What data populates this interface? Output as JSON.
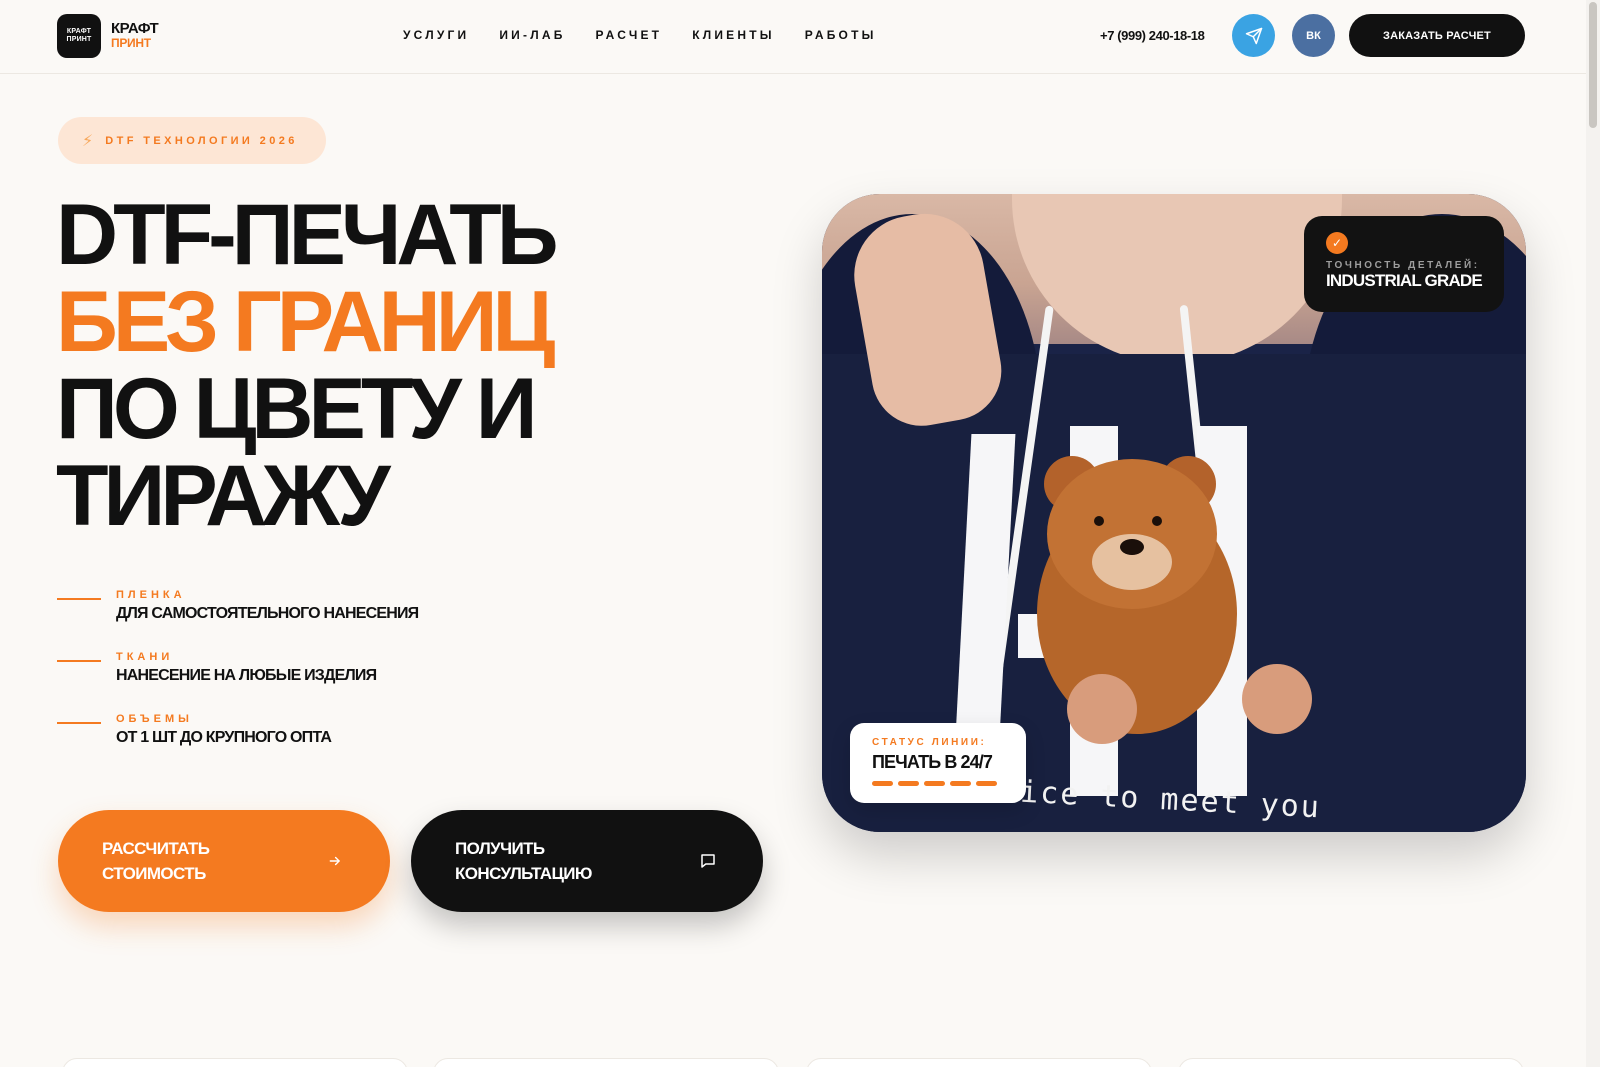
{
  "header": {
    "logo_box_line1": "КРАФТ",
    "logo_box_line2": "ПРИНТ",
    "logo_title": "КРАФТ",
    "logo_subtitle": "ПРИНТ",
    "nav": [
      "УСЛУГИ",
      "ИИ-ЛАБ",
      "РАСЧЕТ",
      "КЛИЕНТЫ",
      "РАБОТЫ"
    ],
    "phone": "+7 (999) 240-18-18",
    "vk_label": "ВК",
    "order_button": "ЗАКАЗАТЬ РАСЧЕТ"
  },
  "hero": {
    "badge": "DTF ТЕХНОЛОГИИ 2026",
    "headline_1": "DTF-ПЕЧАТЬ",
    "headline_2": "БЕЗ ГРАНИЦ",
    "headline_3": "ПО ЦВЕТУ И",
    "headline_4": "ТИРАЖУ",
    "features": [
      {
        "key": "ПЛЕНКА",
        "value": "ДЛЯ САМОСТОЯТЕЛЬНОГО НАНЕСЕНИЯ"
      },
      {
        "key": "ТКАНИ",
        "value": "НАНЕСЕНИЕ НА ЛЮБЫЕ ИЗДЕЛИЯ"
      },
      {
        "key": "ОБЪЕМЫ",
        "value": "ОТ 1 ШТ ДО КРУПНОГО ОПТА"
      }
    ],
    "cta_calc_line1": "РАССЧИТАТЬ",
    "cta_calc_line2": "СТОИМОСТЬ",
    "cta_consult_line1": "ПОЛУЧИТЬ",
    "cta_consult_line2": "КОНСУЛЬТАЦИЮ"
  },
  "image": {
    "slogan": "nice to meet you",
    "card_top_key": "ТОЧНОСТЬ ДЕТАЛЕЙ:",
    "card_top_value": "INDUSTRIAL GRADE",
    "card_bottom_key": "СТАТУС ЛИНИИ:",
    "card_bottom_value": "ПЕЧАТЬ В 24/7",
    "status_segments": 5
  },
  "colors": {
    "accent": "#f47a20",
    "dark": "#111111",
    "background": "#fbf9f6",
    "telegram": "#3aa3e3",
    "vk": "#4b6fa1"
  },
  "icons": {
    "telegram": "paper-plane-icon",
    "arrow": "arrow-right-icon",
    "chat": "chat-bubble-icon",
    "bolt": "lightning-icon",
    "check": "check-icon"
  }
}
